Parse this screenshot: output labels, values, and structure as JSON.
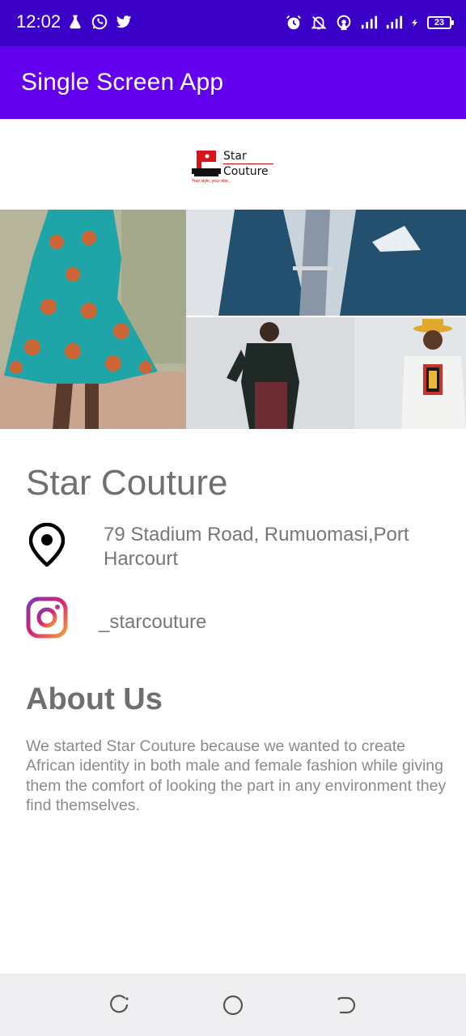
{
  "status_bar": {
    "time": "12:02",
    "battery": "23",
    "left_icons": [
      "flask-icon",
      "whatsapp-icon",
      "twitter-icon"
    ],
    "right_icons": [
      "alarm-icon",
      "bell-off-icon",
      "hotspot-icon",
      "signal-icon",
      "signal-icon",
      "charging-icon",
      "battery-icon"
    ]
  },
  "app_bar": {
    "title": "Single Screen App",
    "color": "#6200ee"
  },
  "logo": {
    "line1": "Star",
    "line2": "Couture",
    "tagline": "Your style, your vibe..."
  },
  "shop": {
    "name": "Star Couture",
    "address": "79 Stadium Road, Rumuomasi,Port Harcourt",
    "instagram": "_starcouture"
  },
  "about": {
    "title": "About Us",
    "text": "We started Star Couture because we wanted to create African identity in both male and female fashion while giving them the comfort of looking the part in any environment they find themselves."
  },
  "nav": {
    "buttons": [
      "back-icon",
      "home-icon",
      "recents-icon"
    ]
  }
}
